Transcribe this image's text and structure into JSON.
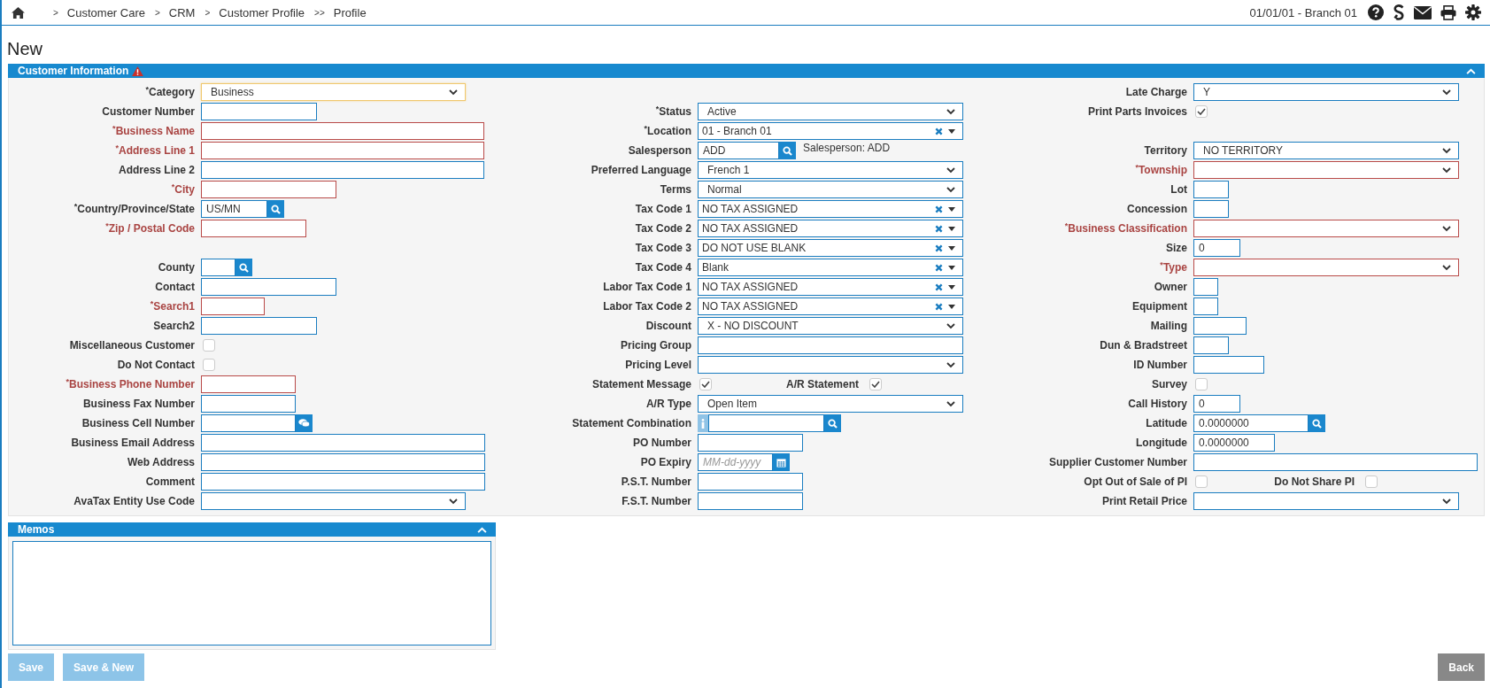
{
  "breadcrumbs": [
    {
      "separator": ">",
      "label": "Customer Care"
    },
    {
      "separator": ">",
      "label": "CRM"
    },
    {
      "separator": ">",
      "label": "Customer Profile"
    },
    {
      "separator": ">>",
      "label": "Profile"
    }
  ],
  "context": "01/01/01 - Branch 01",
  "page_title": "New",
  "customer_panel": {
    "title": "Customer Information",
    "warning": true,
    "expanded": true,
    "columns": [
      [
        {
          "kind": "select",
          "label": "$^{*}$Category",
          "focused": true,
          "value": "Business"
        },
        {
          "kind": "text",
          "label": "Customer Number"
        },
        {
          "kind": "text",
          "label": "$^{*}$Business Name",
          "invalid": true
        },
        {
          "kind": "text",
          "label": "$^{*}$Address Line 1",
          "invalid": true
        },
        {
          "kind": "text",
          "label": "Address Line 2"
        },
        {
          "kind": "text",
          "label": "$^{*}$City",
          "invalid": true
        },
        {
          "kind": "lookup",
          "label": "$^{*}$Country/Province/State",
          "value": "US/MN"
        },
        {
          "kind": "text",
          "label": "$^{*}$Zip / Postal Code",
          "invalid": true
        },
        {
          "kind": "gap"
        },
        {
          "kind": "lookup",
          "label": "County"
        },
        {
          "kind": "text",
          "label": "Contact"
        },
        {
          "kind": "text",
          "label": "$^{*}$Search1",
          "invalid": true
        },
        {
          "kind": "text",
          "label": "Search2"
        },
        {
          "kind": "checkbox",
          "label": "Miscellaneous Customer",
          "checked": false
        },
        {
          "kind": "checkbox",
          "label": "Do Not Contact",
          "checked": false
        },
        {
          "kind": "text",
          "label": "$^{*}$Business Phone Number",
          "invalid": true
        },
        {
          "kind": "text",
          "label": "Business Fax Number"
        },
        {
          "kind": "chat",
          "label": "Business Cell Number"
        },
        {
          "kind": "text",
          "label": "Business Email Address"
        },
        {
          "kind": "text",
          "label": "Web Address"
        },
        {
          "kind": "text",
          "label": "Comment"
        },
        {
          "kind": "select",
          "label": "AvaTax Entity Use Code"
        }
      ],
      [
        {
          "kind": "gap"
        },
        {
          "kind": "select",
          "label": "$^{*}$Status",
          "value": "Active"
        },
        {
          "kind": "combo",
          "label": "$^{*}$Location",
          "value": "01 - Branch 01"
        },
        {
          "kind": "lookup",
          "label": "Salesperson",
          "value": "ADD",
          "note": "Salesperson: ADD"
        },
        {
          "kind": "select",
          "label": "Preferred Language",
          "value": "French 1"
        },
        {
          "kind": "select",
          "label": "Terms",
          "value": "Normal"
        },
        {
          "kind": "combo",
          "label": "Tax Code 1",
          "value": "NO TAX ASSIGNED"
        },
        {
          "kind": "combo",
          "label": "Tax Code 2",
          "value": "NO TAX ASSIGNED"
        },
        {
          "kind": "combo",
          "label": "Tax Code 3",
          "value": "DO NOT USE BLANK"
        },
        {
          "kind": "combo",
          "label": "Tax Code 4",
          "value": "Blank"
        },
        {
          "kind": "combo",
          "label": "Labor Tax Code 1",
          "value": "NO TAX ASSIGNED"
        },
        {
          "kind": "combo",
          "label": "Labor Tax Code 2",
          "value": "NO TAX ASSIGNED"
        },
        {
          "kind": "select",
          "label": "Discount",
          "value": "X - NO DISCOUNT"
        },
        {
          "kind": "text",
          "label": "Pricing Group"
        },
        {
          "kind": "select",
          "label": "Pricing Level"
        },
        {
          "kind": "checkbox_pair",
          "label": "Statement Message",
          "checked": true,
          "second": {
            "label": "A/R Statement",
            "checked": true
          }
        },
        {
          "kind": "select",
          "label": "A/R Type",
          "value": "Open Item"
        },
        {
          "kind": "info_lookup",
          "label": "Statement Combination"
        },
        {
          "kind": "text",
          "label": "PO Number"
        },
        {
          "kind": "date",
          "label": "PO Expiry",
          "placeholder": "MM-dd-yyyy"
        },
        {
          "kind": "text",
          "label": "P.S.T. Number"
        },
        {
          "kind": "text",
          "label": "F.S.T. Number"
        }
      ],
      [
        {
          "kind": "select",
          "label": "Late Charge",
          "value": "Y"
        },
        {
          "kind": "checkbox",
          "label": "Print Parts Invoices",
          "checked": true
        },
        {
          "kind": "gap"
        },
        {
          "kind": "select",
          "label": "Territory",
          "value": "NO TERRITORY"
        },
        {
          "kind": "select",
          "label": "$^{*}$Township",
          "invalid": true
        },
        {
          "kind": "text",
          "label": "Lot"
        },
        {
          "kind": "text",
          "label": "Concession"
        },
        {
          "kind": "select",
          "label": "$^{*}$Business Classification",
          "invalid": true
        },
        {
          "kind": "text",
          "label": "Size",
          "value": "0"
        },
        {
          "kind": "select",
          "label": "$^{*}$Type",
          "invalid": true
        },
        {
          "kind": "text",
          "label": "Owner"
        },
        {
          "kind": "text",
          "label": "Equipment"
        },
        {
          "kind": "text",
          "label": "Mailing"
        },
        {
          "kind": "text",
          "label": "Dun & Bradstreet"
        },
        {
          "kind": "text",
          "label": "ID Number"
        },
        {
          "kind": "checkbox",
          "label": "Survey",
          "checked": false
        },
        {
          "kind": "text",
          "label": "Call History",
          "value": "0"
        },
        {
          "kind": "lookup",
          "label": "Latitude",
          "value": "0.0000000"
        },
        {
          "kind": "text",
          "label": "Longitude",
          "value": "0.0000000"
        },
        {
          "kind": "text",
          "label": "Supplier Customer Number"
        },
        {
          "kind": "checkbox_pair",
          "label": "Opt Out of Sale of PI",
          "checked": false,
          "second": {
            "label": "Do Not Share PI",
            "checked": false
          }
        },
        {
          "kind": "select",
          "label": "Print Retail Price"
        }
      ]
    ]
  },
  "memos_panel": {
    "title": "Memos",
    "expanded": true
  },
  "buttons": [
    {
      "label": "Save",
      "disabled": true
    },
    {
      "label": "Save & New",
      "disabled": true
    }
  ],
  "back_button": {
    "label": "Back",
    "disabled": false
  }
}
